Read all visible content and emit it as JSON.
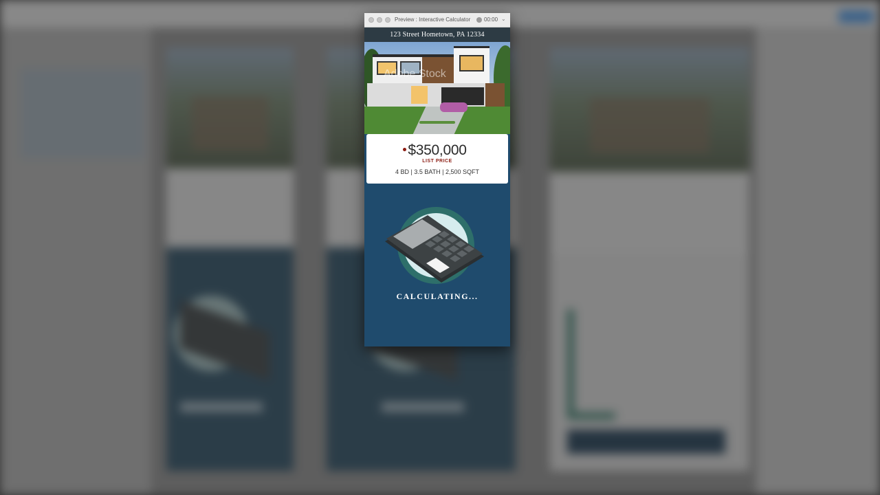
{
  "window": {
    "title": "Preview : Interactive Calculator",
    "timer": "00:00"
  },
  "listing": {
    "address": "123 Street Hometown, PA 12334",
    "photo_watermark": "Adobe Stock",
    "price": "$350,000",
    "price_label": "LIST PRICE",
    "specs": "4 BD | 3.5 BATH | 2,500 SQFT"
  },
  "status": {
    "label": "CALCULATING..."
  },
  "colors": {
    "panel_blue": "#1f4b6d",
    "address_bar": "#2d3b44",
    "price_accent": "#8b1c12",
    "calculator_body": "#3d4244",
    "circle_ring": "#2e6f6a",
    "circle_fill": "#d6ecee"
  },
  "icons": {
    "calculator": "calculator-icon",
    "record": "record-icon",
    "dropdown": "chevron-down-icon"
  }
}
